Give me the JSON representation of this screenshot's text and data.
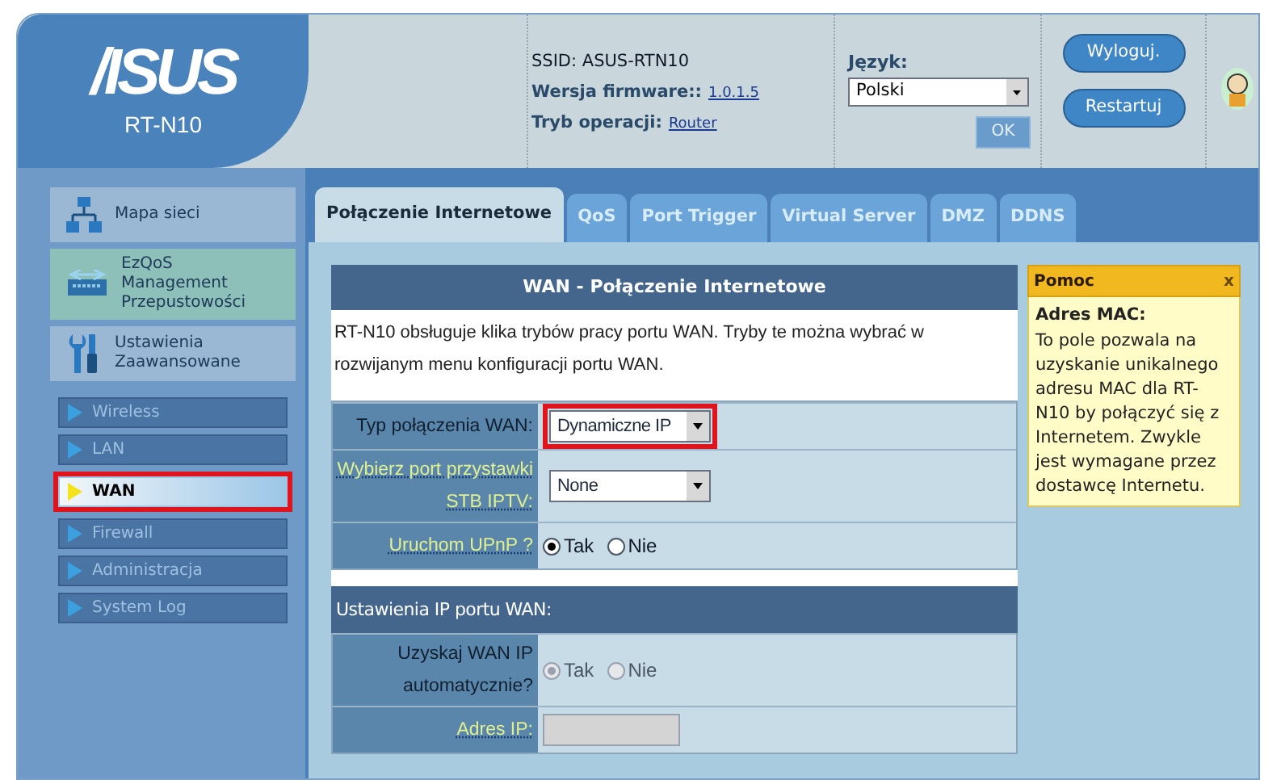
{
  "header": {
    "logo": "/ISUS",
    "model": "RT-N10",
    "ssid": "SSID: ASUS-RTN10",
    "firmware_label": "Wersja firmware::",
    "firmware_version": "1.0.1.5",
    "mode_label": "Tryb operacji:",
    "mode_value": "Router",
    "language_label": "Język:",
    "language_value": "Polski",
    "ok_button": {
      "label": "OK",
      "disabled": true
    },
    "buttons": [
      "Wyloguj.",
      "Restartuj"
    ]
  },
  "sidebar": {
    "sections": [
      {
        "kind": "map",
        "label": "Mapa sieci",
        "selected": false
      },
      {
        "kind": "qos",
        "label": "EzQoS Management Przepustowości",
        "selected": true
      },
      {
        "kind": "tools",
        "label": "Ustawienia Zaawansowane",
        "selected": false
      }
    ],
    "items": [
      {
        "label": "Wireless",
        "selected": false,
        "highlighted": false
      },
      {
        "label": "LAN",
        "selected": false,
        "highlighted": false
      },
      {
        "label": "WAN",
        "selected": true,
        "highlighted": true
      },
      {
        "label": "Firewall",
        "selected": false,
        "highlighted": false
      },
      {
        "label": "Administracja",
        "selected": false,
        "highlighted": false
      },
      {
        "label": "System Log",
        "selected": false,
        "highlighted": false
      }
    ]
  },
  "tabs": [
    {
      "label": "Połączenie Internetowe",
      "selected": true
    },
    {
      "label": "QoS",
      "selected": false
    },
    {
      "label": "Port Trigger",
      "selected": false
    },
    {
      "label": "Virtual Server",
      "selected": false
    },
    {
      "label": "DMZ",
      "selected": false
    },
    {
      "label": "DDNS",
      "selected": false
    }
  ],
  "panel": {
    "title": "WAN - Połączenie Internetowe",
    "description": "RT-N10 obsługuje klika trybów pracy portu WAN. Tryby te można wybrać w rozwijanym menu konfiguracji portu WAN.",
    "fields": [
      {
        "kind": "select",
        "label": "Typ połączenia WAN:",
        "hint": false,
        "value": "Dynamiczne IP",
        "highlighted": true
      },
      {
        "kind": "select",
        "label": "Wybierz port przystawki STB IPTV:",
        "hint": true,
        "value": "None",
        "highlighted": false
      },
      {
        "kind": "radio",
        "label": "Uruchom UPnP ?",
        "hint": true,
        "disabled": false,
        "options": [
          {
            "label": "Tak",
            "selected": true
          },
          {
            "label": "Nie",
            "selected": false
          }
        ]
      }
    ],
    "section_title": "Ustawienia IP portu WAN:",
    "section_fields": [
      {
        "kind": "radio",
        "label": "Uzyskaj WAN IP automatycznie?",
        "hint": false,
        "disabled": true,
        "options": [
          {
            "label": "Tak",
            "selected": true
          },
          {
            "label": "Nie",
            "selected": false
          }
        ]
      },
      {
        "kind": "text",
        "label": "Adres IP:",
        "hint": true,
        "disabled": true
      }
    ]
  },
  "help": {
    "title": "Pomoc",
    "close": "x",
    "heading": "Adres MAC:",
    "text": "To pole pozwala na uzyskanie unikalnego adresu MAC dla RT-N10 by połączyć się z Internetem. Zwykle jest wymagane przez dostawcę Internetu."
  }
}
